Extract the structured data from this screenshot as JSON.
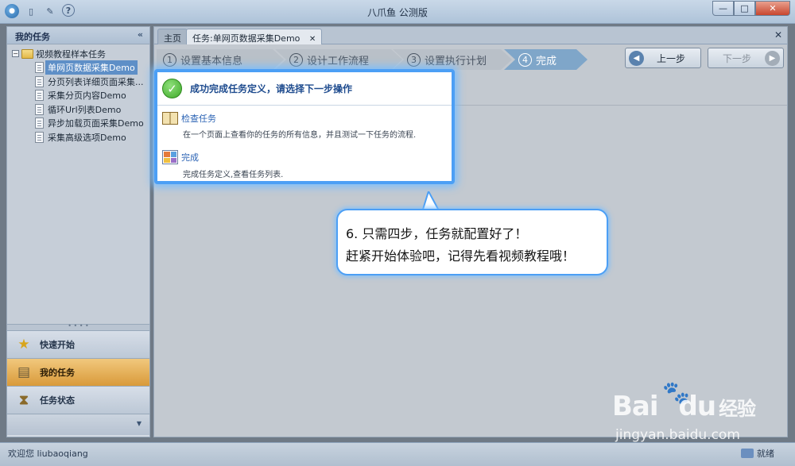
{
  "window": {
    "title": "八爪鱼 公测版",
    "min_glyph": "—",
    "max_glyph": "□",
    "close_glyph": "✕"
  },
  "toolbar_icons": [
    "logo-icon",
    "document-icon",
    "pencil-icon",
    "help-icon"
  ],
  "sidebar": {
    "header": "我的任务",
    "collapse_glyph": "«",
    "tree": {
      "root_label": "视频教程样本任务",
      "items": [
        {
          "label": "单网页数据采集Demo",
          "selected": true
        },
        {
          "label": "分页列表详细页面采集..."
        },
        {
          "label": "采集分页内容Demo"
        },
        {
          "label": "循环Url列表Demo"
        },
        {
          "label": "异步加载页面采集Demo"
        },
        {
          "label": "采集高级选项Demo"
        }
      ]
    },
    "nav": [
      {
        "label": "快速开始",
        "icon": "star-icon"
      },
      {
        "label": "我的任务",
        "icon": "tasks-icon",
        "active": true
      },
      {
        "label": "任务状态",
        "icon": "hourglass-icon"
      }
    ]
  },
  "tabs": {
    "home": "主页",
    "active": "任务:单网页数据采集Demo",
    "close_glyph": "✕"
  },
  "wizard": {
    "steps": [
      {
        "num": "1",
        "label": "设置基本信息"
      },
      {
        "num": "2",
        "label": "设计工作流程"
      },
      {
        "num": "3",
        "label": "设置执行计划"
      },
      {
        "num": "4",
        "label": "完成",
        "active": true
      }
    ],
    "prev_label": "上一步",
    "next_label": "下一步"
  },
  "dialog": {
    "title": "成功完成任务定义，请选择下一步操作",
    "items": [
      {
        "title": "检查任务",
        "desc": "在一个页面上查看你的任务的所有信息，并且测试一下任务的流程.",
        "icon": "book-icon"
      },
      {
        "title": "完成",
        "desc": "完成任务定义,查看任务列表.",
        "icon": "grid-icon"
      }
    ]
  },
  "bubble": {
    "line1": "6. 只需四步，任务就配置好了！",
    "line2": "赶紧开始体验吧，记得先看视频教程哦！"
  },
  "status": {
    "left": "欢迎您 liubaoqiang",
    "right": "就绪"
  },
  "watermark": {
    "brand": "Bai",
    "brand2": "du",
    "suffix": "经验",
    "url": "jingyan.baidu.com"
  },
  "colors": {
    "accent": "#4c9ff5",
    "active_nav": "#d99a3a",
    "active_step": "#7fa6c9",
    "selected_tree": "#5e8fc7",
    "success": "#3fa92a"
  }
}
